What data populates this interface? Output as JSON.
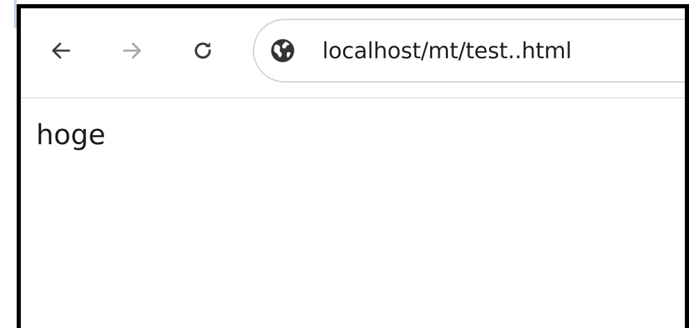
{
  "browser": {
    "back_icon": "arrow-left-icon",
    "forward_icon": "arrow-right-icon",
    "reload_icon": "reload-icon",
    "site_icon": "globe-icon",
    "url": "localhost/mt/test..html"
  },
  "page": {
    "text": "hoge"
  }
}
